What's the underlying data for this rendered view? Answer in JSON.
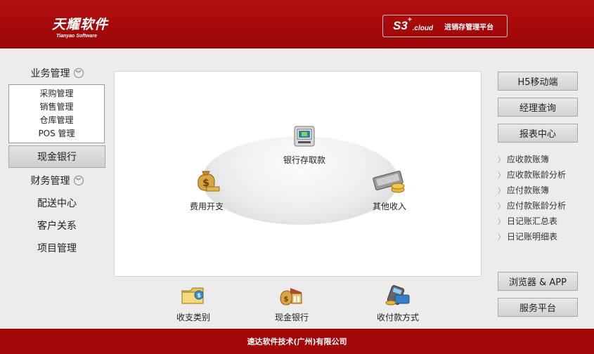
{
  "header": {
    "logo_cn": "天耀软件",
    "logo_en": "Tianyao Software",
    "badge_s3": "S3",
    "badge_sup": "+",
    "badge_cloud": ".cloud",
    "badge_text": "进销存管理平台"
  },
  "sidebar": {
    "business": "业务管理",
    "sub_items": [
      "采购管理",
      "销售管理",
      "仓库管理",
      "POS 管理"
    ],
    "cash_bank": "现金银行",
    "finance": "财务管理",
    "delivery": "配送中心",
    "customer": "客户关系",
    "project": "项目管理"
  },
  "main": {
    "deposit": "银行存取款",
    "expense": "费用开支",
    "other_income": "其他收入"
  },
  "bottom": {
    "categories": "收支类别",
    "cash_bank": "现金银行",
    "payment": "收付款方式"
  },
  "right": {
    "h5": "H5移动端",
    "manager": "经理查询",
    "report_center": "报表中心",
    "reports": [
      "应收款账簿",
      "应收款账龄分析",
      "应付款账簿",
      "应付款账龄分析",
      "日记账汇总表",
      "日记账明细表"
    ],
    "browser_app": "浏览器 & APP",
    "service": "服务平台"
  },
  "footer": {
    "company": "速达软件技术(广州)有限公司"
  }
}
